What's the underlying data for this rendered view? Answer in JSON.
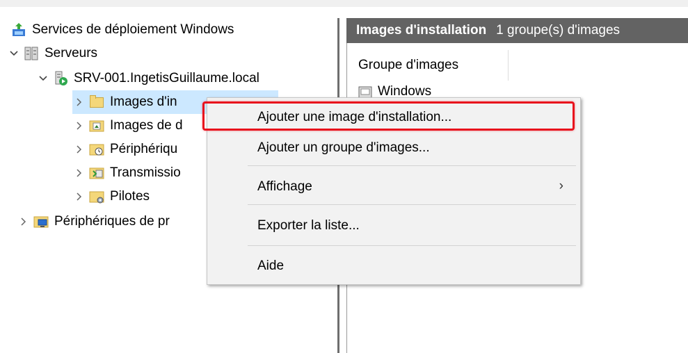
{
  "tree": {
    "root": "Services de déploiement Windows",
    "servers": "Serveurs",
    "server": "SRV-001.IngetisGuillaume.local",
    "children": [
      "Images d'in",
      "Images de d",
      "Périphériqu",
      "Transmissio",
      "Pilotes"
    ],
    "other": "Périphériques de pr"
  },
  "right": {
    "header_title": "Images d'installation",
    "header_sub": "1 groupe(s) d'images",
    "column": "Groupe d'images",
    "first_row": "Windows"
  },
  "menu": {
    "items": [
      "Ajouter une image d'installation...",
      "Ajouter un groupe d'images...",
      "Affichage",
      "Exporter la liste...",
      "Aide"
    ],
    "submenu_arrow": "›"
  },
  "colors": {
    "highlight": "#e8101c",
    "selection": "#cce8ff",
    "header_bg": "#636363"
  }
}
